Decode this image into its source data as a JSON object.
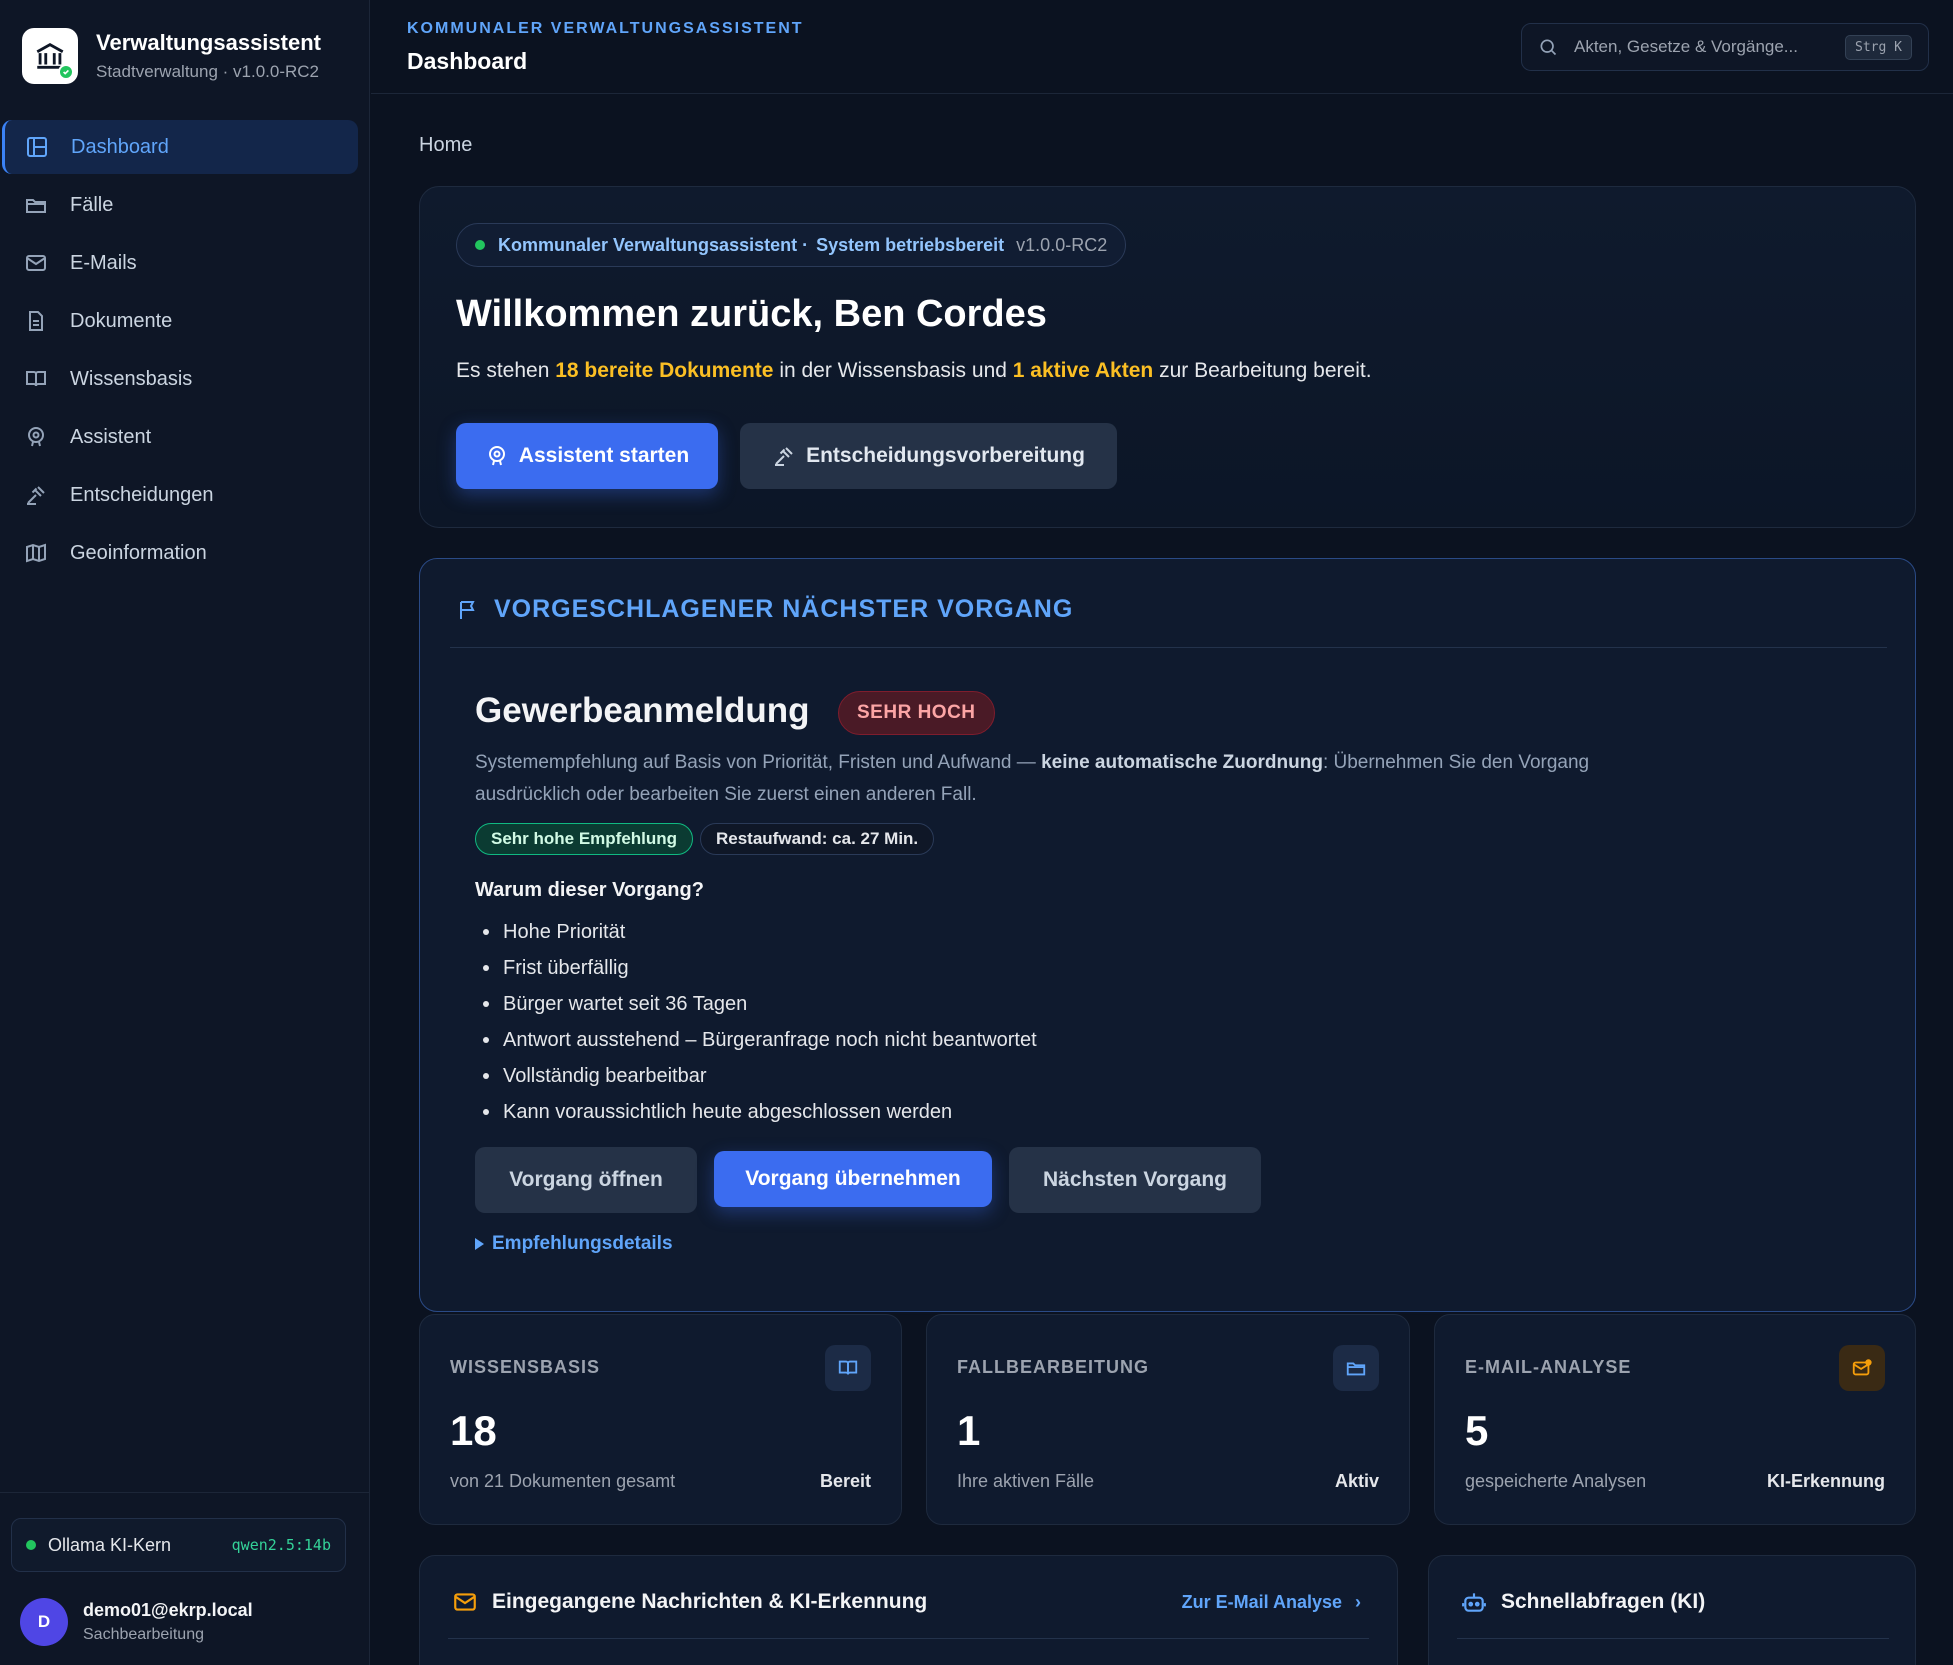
{
  "brand": {
    "title": "Verwaltungsassistent",
    "subtitle": "Stadtverwaltung · v1.0.0-RC2"
  },
  "nav": [
    {
      "label": "Dashboard",
      "icon": "dashboard-icon",
      "active": true
    },
    {
      "label": "Fälle",
      "icon": "folder-icon"
    },
    {
      "label": "E-Mails",
      "icon": "mail-icon"
    },
    {
      "label": "Dokumente",
      "icon": "document-icon"
    },
    {
      "label": "Wissensbasis",
      "icon": "book-icon"
    },
    {
      "label": "Assistent",
      "icon": "assistant-icon"
    },
    {
      "label": "Entscheidungen",
      "icon": "gavel-icon"
    },
    {
      "label": "Geoinformation",
      "icon": "map-icon"
    }
  ],
  "ollama": {
    "label": "Ollama KI-Kern",
    "model": "qwen2.5:14b"
  },
  "user": {
    "initial": "D",
    "email": "demo01@ekrp.local",
    "role": "Sachbearbeitung"
  },
  "header": {
    "kicker": "KOMMUNALER VERWALTUNGSASSISTENT",
    "title": "Dashboard",
    "search_placeholder": "Akten, Gesetze & Vorgänge...",
    "search_shortcut": "Strg K"
  },
  "breadcrumb": "Home",
  "welcome": {
    "pill_app": "Kommunaler Verwaltungsassistent ·",
    "pill_status": "System betriebsbereit",
    "pill_version": "v1.0.0-RC2",
    "title": "Willkommen zurück, Ben Cordes",
    "sub_1": "Es stehen ",
    "sub_hl_1": "18 bereite Dokumente",
    "sub_2": " in der Wissensbasis und ",
    "sub_hl_2": "1 aktive Akten",
    "sub_3": " zur Bearbeitung bereit.",
    "btn_primary": "Assistent starten",
    "btn_secondary": "Entscheidungsvorbereitung"
  },
  "suggestion": {
    "heading": "VORGESCHLAGENER NÄCHSTER VORGANG",
    "case_title": "Gewerbeanmeldung",
    "priority": "SEHR HOCH",
    "desc_1": "Systemempfehlung auf Basis von Priorität, Fristen und Aufwand — ",
    "desc_bold": "keine automatische Zuordnung",
    "desc_2": ": Übernehmen Sie den Vorgang ausdrücklich oder bearbeiten Sie zuerst einen anderen Fall.",
    "chip_recommend": "Sehr hohe Empfehlung",
    "chip_effort": "Restaufwand: ca. 27 Min.",
    "why_title": "Warum dieser Vorgang?",
    "reasons": [
      "Hohe Priorität",
      "Frist überfällig",
      "Bürger wartet seit 36 Tagen",
      "Antwort ausstehend – Bürgeranfrage noch nicht beantwortet",
      "Vollständig bearbeitbar",
      "Kann voraussichtlich heute abgeschlossen werden"
    ],
    "btn_open": "Vorgang öffnen",
    "btn_take": "Vorgang übernehmen",
    "btn_next": "Nächsten Vorgang",
    "details": "Empfehlungsdetails"
  },
  "stats": [
    {
      "label": "WISSENSBASIS",
      "value": "18",
      "desc": "von 21 Dokumenten gesamt",
      "state": "Bereit",
      "icon": "book-icon",
      "color": "#60a5fa"
    },
    {
      "label": "FALLBEARBEITUNG",
      "value": "1",
      "desc": "Ihre aktiven Fälle",
      "state": "Aktiv",
      "icon": "folder-icon",
      "color": "#60a5fa"
    },
    {
      "label": "E-MAIL-ANALYSE",
      "value": "5",
      "desc": "gespeicherte Analysen",
      "state": "KI-Erkennung",
      "icon": "mail-alert-icon",
      "color": "#f59e0b"
    }
  ],
  "panels": {
    "messages_title": "Eingegangene Nachrichten & KI-Erkennung",
    "messages_link": "Zur E-Mail Analyse",
    "quick_title": "Schnellabfragen (KI)"
  },
  "colors": {
    "accent": "#3b6cf0",
    "highlight": "#fbbf24",
    "success": "#22c55e",
    "danger": "#fca5a5"
  }
}
